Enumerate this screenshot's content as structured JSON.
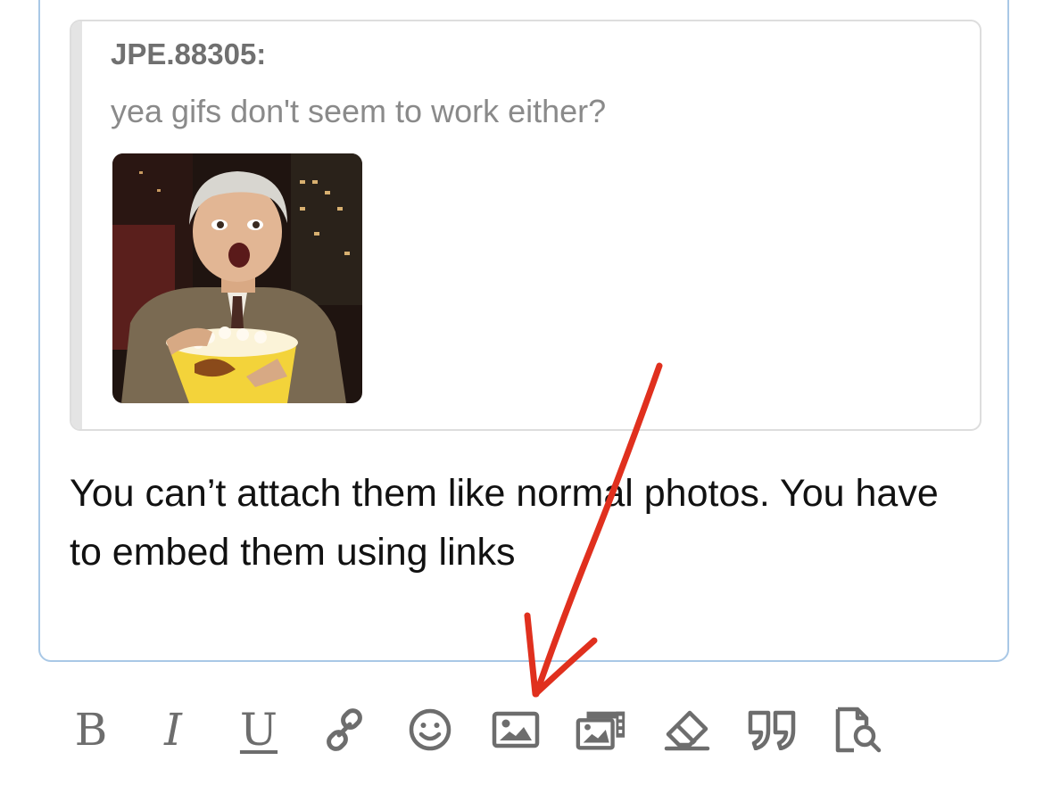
{
  "quote": {
    "author": "JPE.88305:",
    "text": "yea gifs don't seem to work either?"
  },
  "reply": {
    "text": "You can’t attach them like normal photos. You have to embed them using links"
  },
  "toolbar": {
    "buttons": [
      {
        "label": "B",
        "icon": "bold-icon"
      },
      {
        "label": "I",
        "icon": "italic-icon"
      },
      {
        "label": "U",
        "icon": "underline-icon"
      },
      {
        "icon": "link-icon"
      },
      {
        "icon": "emoji-icon"
      },
      {
        "icon": "image-icon"
      },
      {
        "icon": "gallery-icon"
      },
      {
        "icon": "eraser-icon"
      },
      {
        "icon": "quote-icon"
      },
      {
        "icon": "preview-icon"
      }
    ]
  },
  "colors": {
    "editor_border": "#a9c8e6",
    "quote_border": "#dddddd",
    "toolbar_icon": "#6d6d6d",
    "annotation_arrow": "#e0301e"
  }
}
